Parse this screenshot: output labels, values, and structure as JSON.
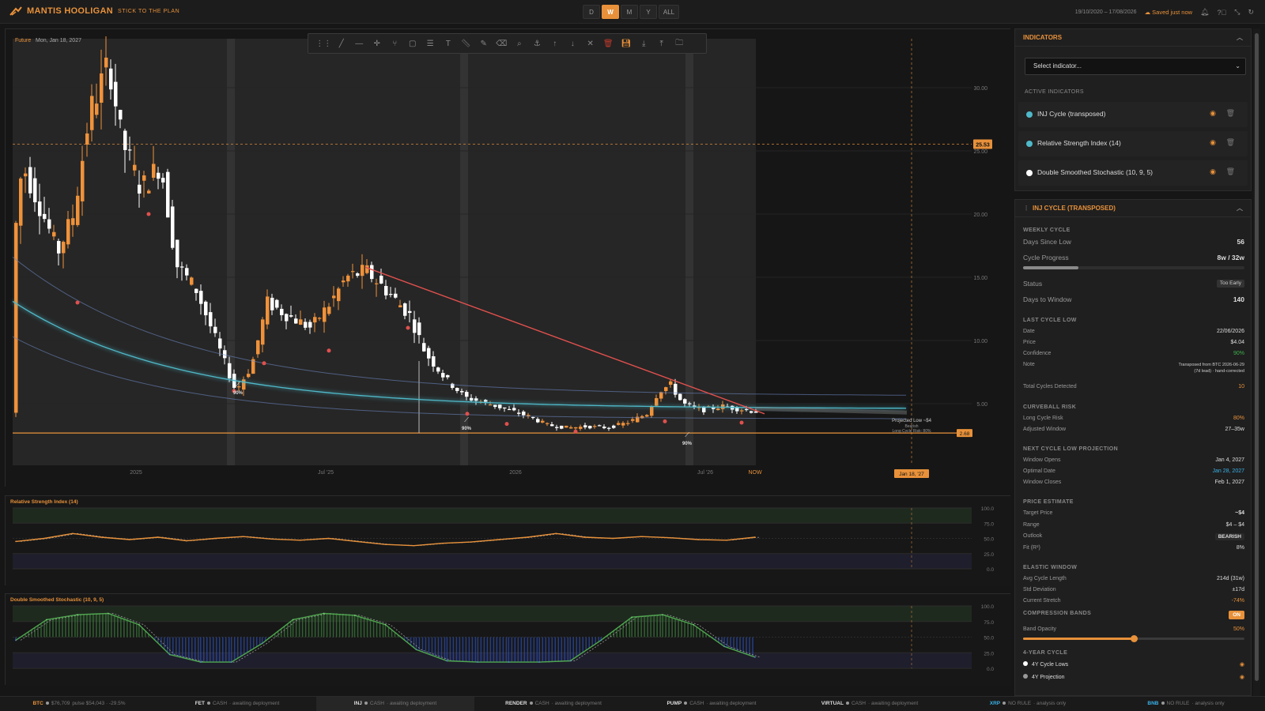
{
  "app": {
    "name": "MANTIS HOOLIGAN",
    "tagline": "STICK TO THE PLAN"
  },
  "header": {
    "timeframes": [
      {
        "label": "D",
        "active": false
      },
      {
        "label": "W",
        "active": true
      },
      {
        "label": "M",
        "active": false
      },
      {
        "label": "Y",
        "active": false
      },
      {
        "label": "ALL",
        "active": false
      }
    ],
    "date_range": "19/10/2020 – 17/08/2026",
    "saved_label": "Saved just now",
    "icons": [
      "bell-icon",
      "help-icon",
      "collapse-icon",
      "refresh-icon"
    ]
  },
  "chart": {
    "cursor_label": "Future",
    "cursor_date": "Mon, Jan 18, 2027",
    "price_ticks": [
      "30.00",
      "25.00",
      "20.00",
      "15.00",
      "10.00",
      "5.00"
    ],
    "current_price_badge": "25.53",
    "support_badge": "2.68",
    "time_ticks": [
      "2025",
      "Jul '25",
      "2026",
      "Jul '26"
    ],
    "now_label": "NOW",
    "cursor_time_badge": "Jan 18, '27",
    "cycle_labels": [
      "90%",
      "90%",
      "90%"
    ],
    "projection_label_1": "Projected Low ~$4",
    "projection_label_2": "Bearish",
    "projection_label_3": "Long Cycle Risk: 80%",
    "accent_colors": {
      "up": "#f0923a",
      "down": "#ffffff",
      "trend": "#e0504d",
      "cycle": "#4fb9c9",
      "support": "#e8913a"
    }
  },
  "chart_data": [
    {
      "type": "line",
      "title": "Relative Strength Index (14)",
      "ylim": [
        0,
        100
      ],
      "y_ticks": [
        "100.0",
        "75.0",
        "50.0",
        "25.0",
        "0.0"
      ],
      "series": [
        {
          "values": [
            45,
            50,
            58,
            52,
            48,
            52,
            46,
            50,
            53,
            49,
            47,
            50,
            45,
            40,
            38,
            42,
            44,
            48,
            52,
            58,
            52,
            50,
            53,
            51,
            48,
            47,
            52
          ]
        }
      ]
    },
    {
      "type": "line",
      "title": "Double Smoothed Stochastic (10, 9, 5)",
      "ylim": [
        0,
        100
      ],
      "y_ticks": [
        "100.0",
        "75.0",
        "50.0",
        "25.0",
        "0.0"
      ],
      "series": [
        {
          "values": [
            45,
            78,
            86,
            88,
            70,
            22,
            10,
            10,
            40,
            78,
            88,
            85,
            70,
            30,
            12,
            10,
            10,
            10,
            12,
            45,
            82,
            86,
            70,
            35,
            18
          ]
        }
      ]
    }
  ],
  "toolbar": {
    "icons": [
      "grip-icon",
      "trendline-icon",
      "horizontal-line-icon",
      "crosshair-icon",
      "pitchfork-icon",
      "rectangle-icon",
      "fibonacci-icon",
      "text-icon",
      "ruler-icon",
      "brush-icon",
      "eraser-icon",
      "magnifier-icon",
      "anchor-icon",
      "arrow-up-icon",
      "arrow-down-icon",
      "close-icon",
      "delete-icon",
      "save-icon",
      "download-icon",
      "upload-icon",
      "folder-icon"
    ]
  },
  "indicators": {
    "title": "INDICATORS",
    "select_placeholder": "Select indicator...",
    "active_label": "ACTIVE INDICATORS",
    "items": [
      {
        "label": "INJ Cycle (transposed)",
        "color": "#4fb9c9"
      },
      {
        "label": "Relative Strength Index (14)",
        "color": "#4fb9c9"
      },
      {
        "label": "Double Smoothed Stochastic (10, 9, 5)",
        "color": "#ffffff"
      }
    ]
  },
  "cycle": {
    "title": "INJ CYCLE (TRANSPOSED)",
    "weekly": {
      "label": "WEEKLY CYCLE",
      "days_since_low_label": "Days Since Low",
      "days_since_low": "56",
      "progress_label": "Cycle Progress",
      "progress": "8w / 32w",
      "progress_fraction": 0.25,
      "status_label": "Status",
      "status": "Too Early",
      "days_to_window_label": "Days to Window",
      "days_to_window": "140"
    },
    "last_low": {
      "label": "LAST CYCLE LOW",
      "date_label": "Date",
      "date": "22/06/2026",
      "price_label": "Price",
      "price": "$4.04",
      "confidence_label": "Confidence",
      "confidence": "90%",
      "note_label": "Note",
      "note_1": "Transposed from BTC 2026-06-29",
      "note_2": "(7d lead) · hand-corrected",
      "total_label": "Total Cycles Detected",
      "total": "10"
    },
    "curveball": {
      "label": "CURVEBALL RISK",
      "long_label": "Long Cycle Risk",
      "long": "80%",
      "window_label": "Adjusted Window",
      "window": "27–35w"
    },
    "projection": {
      "label": "NEXT CYCLE LOW PROJECTION",
      "opens_label": "Window Opens",
      "opens": "Jan 4, 2027",
      "optimal_label": "Optimal Date",
      "optimal": "Jan 28, 2027",
      "closes_label": "Window Closes",
      "closes": "Feb 1, 2027"
    },
    "estimate": {
      "label": "PRICE ESTIMATE",
      "target_label": "Target Price",
      "target": "~$4",
      "range_label": "Range",
      "range": "$4 – $4",
      "outlook_label": "Outlook",
      "outlook": "BEARISH",
      "fit_label": "Fit (R²)",
      "fit": "8%"
    },
    "elastic": {
      "label": "ELASTIC WINDOW",
      "avg_label": "Avg Cycle Length",
      "avg": "214d (31w)",
      "std_label": "Std Deviation",
      "std": "±17d",
      "stretch_label": "Current Stretch",
      "stretch": "-74%"
    },
    "bands": {
      "label": "COMPRESSION BANDS",
      "toggle": "ON",
      "opacity_label": "Band Opacity",
      "opacity": "50%",
      "opacity_fraction": 0.5
    },
    "four_year": {
      "label": "4-YEAR CYCLE",
      "items": [
        {
          "label": "4Y Cycle Lows"
        },
        {
          "label": "4Y Projection"
        }
      ]
    }
  },
  "bottom": {
    "tickers": [
      {
        "sym": "BTC",
        "mode": "$76,709",
        "note": "pulse $54,043 · -29.5%",
        "style": "orange",
        "active": false
      },
      {
        "sym": "FET",
        "mode": "CASH",
        "note": "· awaiting deployment",
        "style": "",
        "active": false
      },
      {
        "sym": "INJ",
        "mode": "CASH",
        "note": "· awaiting deployment",
        "style": "",
        "active": true
      },
      {
        "sym": "RENDER",
        "mode": "CASH",
        "note": "· awaiting deployment",
        "style": "",
        "active": false
      },
      {
        "sym": "PUMP",
        "mode": "CASH",
        "note": "· awaiting deployment",
        "style": "",
        "active": false
      },
      {
        "sym": "VIRTUAL",
        "mode": "CASH",
        "note": "· awaiting deployment",
        "style": "",
        "active": false
      },
      {
        "sym": "XRP",
        "mode": "NO RULE",
        "note": "· analysis only",
        "style": "blue",
        "active": false
      },
      {
        "sym": "BNB",
        "mode": "NO RULE",
        "note": "· analysis only",
        "style": "blue",
        "active": false
      }
    ]
  }
}
